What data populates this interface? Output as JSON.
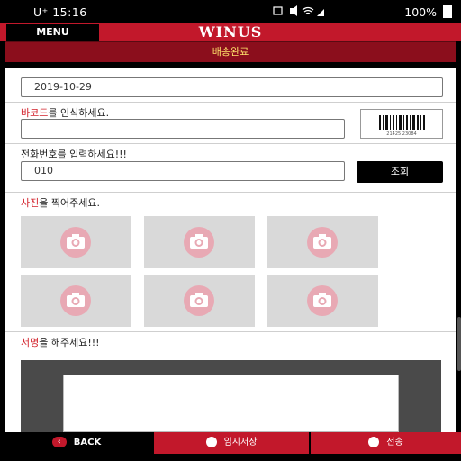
{
  "status_bar": {
    "carrier": "U⁺ 15:16",
    "battery": "100%",
    "icons": [
      "image-icon",
      "mute-icon",
      "wifi-icon",
      "signal-icon"
    ]
  },
  "header": {
    "menu_label": "MENU",
    "brand": "WINUS",
    "subtitle": "배송완료"
  },
  "form": {
    "date_value": "2019-10-29",
    "barcode_label_highlight": "바코드",
    "barcode_label_rest": "를 인식하세요.",
    "barcode_value": "",
    "phone_label": "전화번호를 입력하세요!!!",
    "phone_value": "010",
    "search_button": "조회",
    "photo_label_highlight": "사진",
    "photo_label_rest": "을 찍어주세요.",
    "signature_label_highlight": "서명",
    "signature_label_rest": "을 해주세요!!!",
    "barcode_image_text": "21425   23084"
  },
  "footer": {
    "back_label": "BACK",
    "temp_save_label": "임시저장",
    "send_label": "전송"
  },
  "colors": {
    "brand_red": "#c2182b",
    "dark_red": "#8b0e1c",
    "subtitle_text": "#ffe36b"
  }
}
